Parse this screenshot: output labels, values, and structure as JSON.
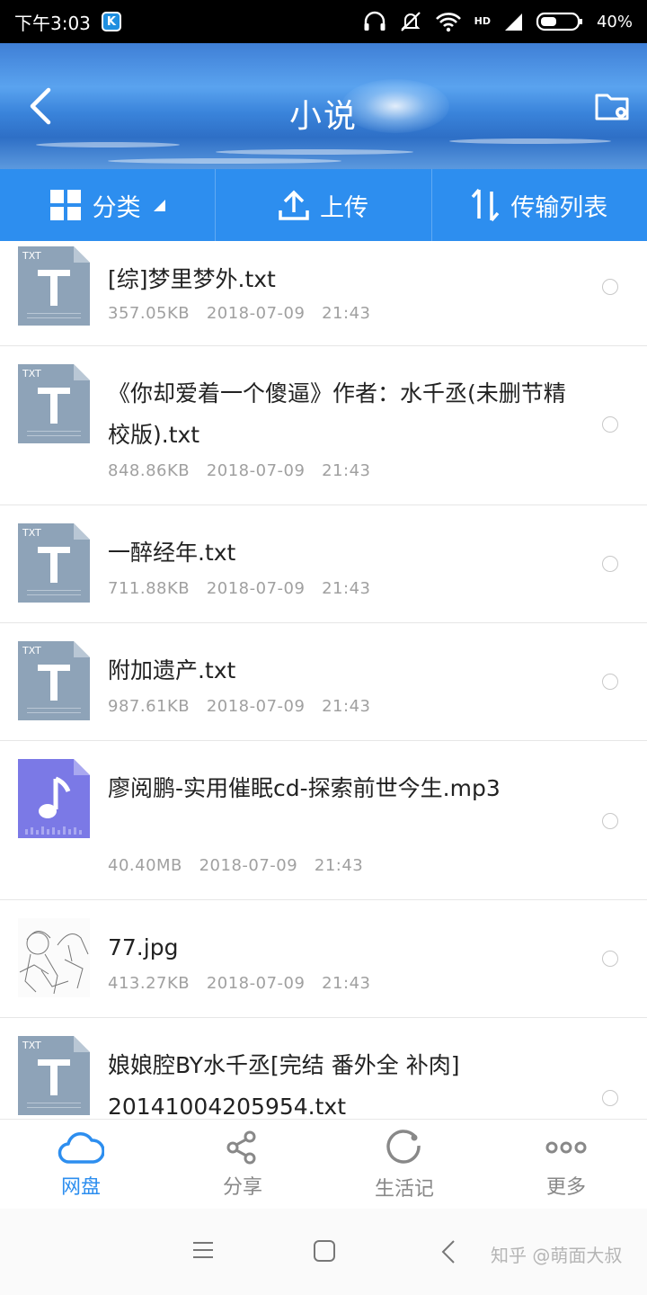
{
  "status_bar": {
    "time": "下午3:03",
    "app_badge": "K",
    "battery": "40%",
    "network": "HD"
  },
  "header": {
    "title": "小说"
  },
  "actions": [
    {
      "label": "分类",
      "icon": "grid-icon"
    },
    {
      "label": "上传",
      "icon": "upload-icon"
    },
    {
      "label": "传输列表",
      "icon": "transfer-icon"
    }
  ],
  "files": [
    {
      "name": "[综]梦里梦外.txt",
      "size": "357.05KB",
      "date": "2018-07-09",
      "time": "21:43",
      "type": "TXT"
    },
    {
      "name": "《你却爱着一个傻逼》作者：水千丞(未删节精校版).txt",
      "size": "848.86KB",
      "date": "2018-07-09",
      "time": "21:43",
      "type": "TXT"
    },
    {
      "name": "一醉经年.txt",
      "size": "711.88KB",
      "date": "2018-07-09",
      "time": "21:43",
      "type": "TXT"
    },
    {
      "name": "附加遗产.txt",
      "size": "987.61KB",
      "date": "2018-07-09",
      "time": "21:43",
      "type": "TXT"
    },
    {
      "name": "廖阅鹏-实用催眠cd-探索前世今生.mp3",
      "size": "40.40MB",
      "date": "2018-07-09",
      "time": "21:43",
      "type": "MP3"
    },
    {
      "name": "77.jpg",
      "size": "413.27KB",
      "date": "2018-07-09",
      "time": "21:43",
      "type": "JPG"
    },
    {
      "name": "娘娘腔BY水千丞[完结 番外全 补肉] 20141004205954.txt",
      "size": "",
      "date": "",
      "time": "",
      "type": "TXT"
    }
  ],
  "tabs": [
    {
      "label": "网盘",
      "icon": "cloud-icon",
      "active": true
    },
    {
      "label": "分享",
      "icon": "share-icon",
      "active": false
    },
    {
      "label": "生活记",
      "icon": "circle-icon",
      "active": false
    },
    {
      "label": "更多",
      "icon": "more-icon",
      "active": false
    }
  ],
  "watermark": "知乎 @萌面大叔",
  "colors": {
    "accent": "#2d8eef",
    "txt_icon": "#8ea3b8",
    "mp3_icon": "#7b79e6"
  }
}
